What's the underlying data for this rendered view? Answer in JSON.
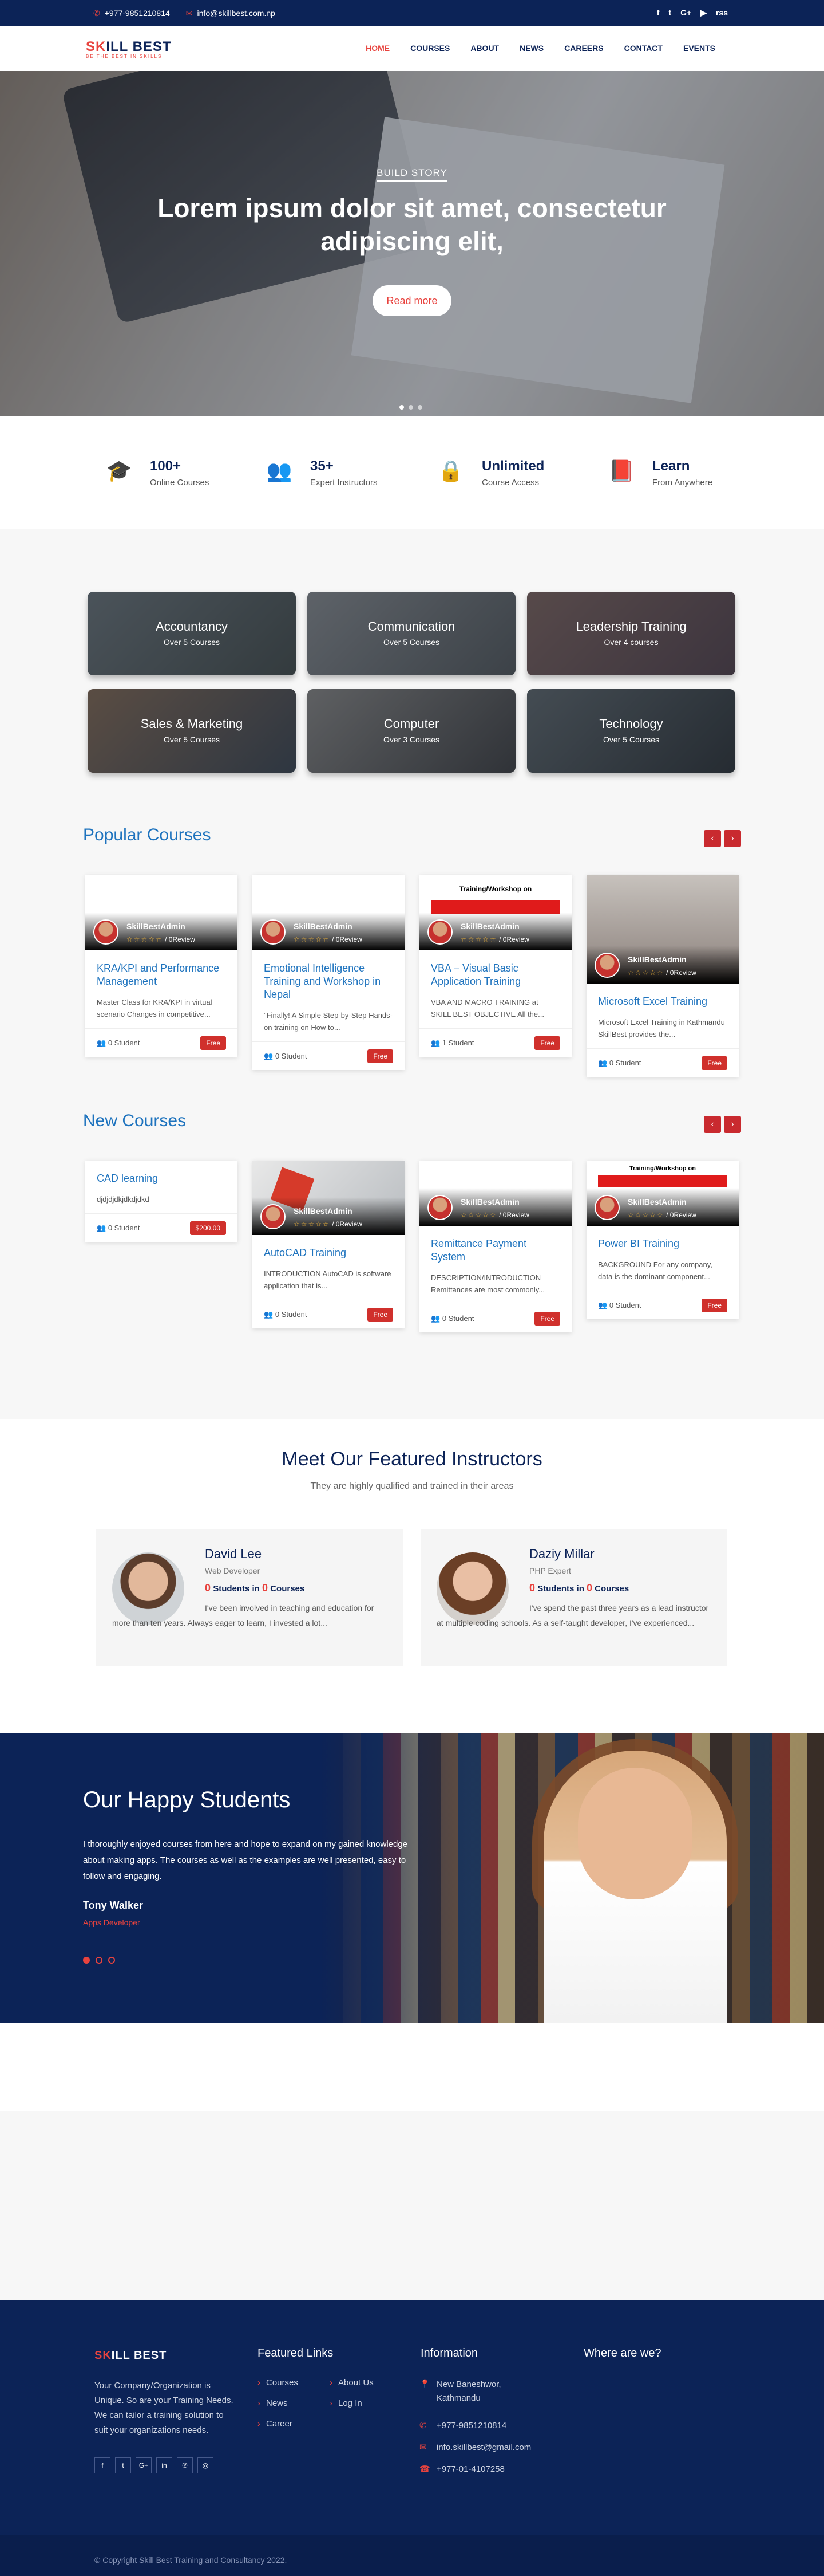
{
  "topbar": {
    "phone": "+977-9851210814",
    "email": "info@skillbest.com.np",
    "social": [
      "f",
      "t",
      "G+",
      "▶",
      "rss"
    ]
  },
  "brand": {
    "logo_a": "SK",
    "logo_b": "ILL BEST",
    "tagline": "BE THE BEST IN SKILLS"
  },
  "nav": [
    "HOME",
    "COURSES",
    "ABOUT",
    "NEWS",
    "CAREERS",
    "CONTACT",
    "EVENTS"
  ],
  "hero": {
    "kicker": "BUILD STORY",
    "headline": "Lorem ipsum dolor sit amet, consectetur adipiscing elit,",
    "button": "Read more"
  },
  "stats": [
    {
      "icon": "graduation-cap-icon",
      "glyph": "🎓",
      "value": "100+",
      "label": "Online Courses"
    },
    {
      "icon": "users-icon",
      "glyph": "👥",
      "value": "35+",
      "label": "Expert Instructors"
    },
    {
      "icon": "lock-icon",
      "glyph": "🔒",
      "value": "Unlimited",
      "label": "Course Access"
    },
    {
      "icon": "book-icon",
      "glyph": "📕",
      "value": "Learn",
      "label": "From Anywhere"
    }
  ],
  "categories": [
    {
      "name": "Accountancy",
      "count": "Over 5 Courses"
    },
    {
      "name": "Communication",
      "count": "Over 5 Courses"
    },
    {
      "name": "Leadership Training",
      "count": "Over 4 courses"
    },
    {
      "name": "Sales & Marketing",
      "count": "Over 5 Courses"
    },
    {
      "name": "Computer",
      "count": "Over 3 Courses"
    },
    {
      "name": "Technology",
      "count": "Over 5 Courses"
    }
  ],
  "popular": {
    "title": "Popular Courses",
    "prev": "‹",
    "next": "›",
    "cards": [
      {
        "admin": "SkillBestAdmin",
        "review": "/ 0Review",
        "title": "KRA/KPI and Performance Management",
        "desc": "Master Class for KRA/KPI in virtual scenario Changes in competitive...",
        "students": "0 Student",
        "price": "Free",
        "banner": ""
      },
      {
        "admin": "SkillBestAdmin",
        "review": "/ 0Review",
        "title": "Emotional Intelligence Training and Workshop in Nepal",
        "desc": "\"Finally! A Simple Step-by-Step Hands-on training on How to...",
        "students": "0 Student",
        "price": "Free",
        "banner": ""
      },
      {
        "admin": "SkillBestAdmin",
        "review": "/ 0Review",
        "title": "VBA – Visual Basic Application Training",
        "desc": "VBA AND MACRO TRAINING at SKILL BEST OBJECTIVE All the...",
        "students": "1 Student",
        "price": "Free",
        "banner": "Training/Workshop on"
      },
      {
        "admin": "SkillBestAdmin",
        "review": "/ 0Review",
        "title": "Microsoft Excel Training",
        "desc": "Microsoft Excel Training in Kathmandu SkillBest provides the...",
        "students": "0 Student",
        "price": "Free",
        "banner": ""
      }
    ]
  },
  "newc": {
    "title": "New Courses",
    "prev": "‹",
    "next": "›",
    "cards": [
      {
        "admin": "",
        "review": "",
        "title": "CAD learning",
        "desc": "djdjdjdkjdkdjdkd",
        "students": "0 Student",
        "price": "$200.00",
        "banner": ""
      },
      {
        "admin": "SkillBestAdmin",
        "review": "/ 0Review",
        "title": "AutoCAD Training",
        "desc": "INTRODUCTION AutoCAD is software application that is...",
        "students": "0 Student",
        "price": "Free",
        "banner": ""
      },
      {
        "admin": "SkillBestAdmin",
        "review": "/ 0Review",
        "title": "Remittance Payment System",
        "desc": "DESCRIPTION/INTRODUCTION Remittances are most commonly...",
        "students": "0 Student",
        "price": "Free",
        "banner": ""
      },
      {
        "admin": "SkillBestAdmin",
        "review": "/ 0Review",
        "title": "Power BI Training",
        "desc": "BACKGROUND For any company, data is the dominant component...",
        "students": "0 Student",
        "price": "Free",
        "banner": "Training/Workshop on"
      }
    ]
  },
  "instructors": {
    "title": "Meet Our Featured Instructors",
    "subtitle": "They are highly qualified and trained in their areas",
    "items": [
      {
        "name": "David Lee",
        "role": "Web Developer",
        "students_n": "0",
        "students_t": "Students in",
        "courses_n": "0",
        "courses_t": "Courses",
        "bio": "I've been involved in teaching and education for more than ten years. Always eager to learn, I invested a lot..."
      },
      {
        "name": "Daziy Millar",
        "role": "PHP Expert",
        "students_n": "0",
        "students_t": "Students in",
        "courses_n": "0",
        "courses_t": "Courses",
        "bio": "I've spend the past three years as a lead instructor at multiple coding schools. As a self-taught developer, I've experienced..."
      }
    ]
  },
  "testimonial": {
    "title": "Our Happy Students",
    "quote": "I thoroughly enjoyed courses from here and hope to expand on my gained knowledge about making apps. The courses as well as the examples are well presented, easy to follow and engaging.",
    "name": "Tony Walker",
    "role": "Apps Developer"
  },
  "footer": {
    "about": "Your Company/Organization is Unique. So are your Training Needs. We can tailor a training solution to suit your organizations needs.",
    "social": [
      "f",
      "t",
      "G+",
      "in",
      "℗",
      "◎"
    ],
    "links_title": "Featured Links",
    "links_col1": [
      "Courses",
      "News",
      "Career"
    ],
    "links_col2": [
      "About Us",
      "Log In"
    ],
    "info_title": "Information",
    "address": "New Baneshwor, Kathmandu",
    "phone": "+977-9851210814",
    "email": "info.skillbest@gmail.com",
    "fax": "+977-01-4107258",
    "where_title": "Where are we?",
    "copyright": "© Copyright Skill Best Training and Consultancy 2022."
  },
  "colors": {
    "navy": "#0c2357",
    "red": "#e8433e",
    "blue": "#1e73be"
  }
}
